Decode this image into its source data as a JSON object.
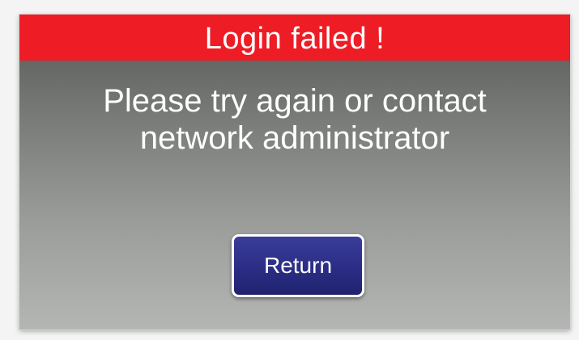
{
  "dialog": {
    "title": "Login failed !",
    "message_line1": "Please try again or contact",
    "message_line2": "network administrator",
    "return_label": "Return"
  },
  "colors": {
    "title_bar": "#ee1c24",
    "button": "#2b2d85",
    "text": "#ffffff"
  }
}
